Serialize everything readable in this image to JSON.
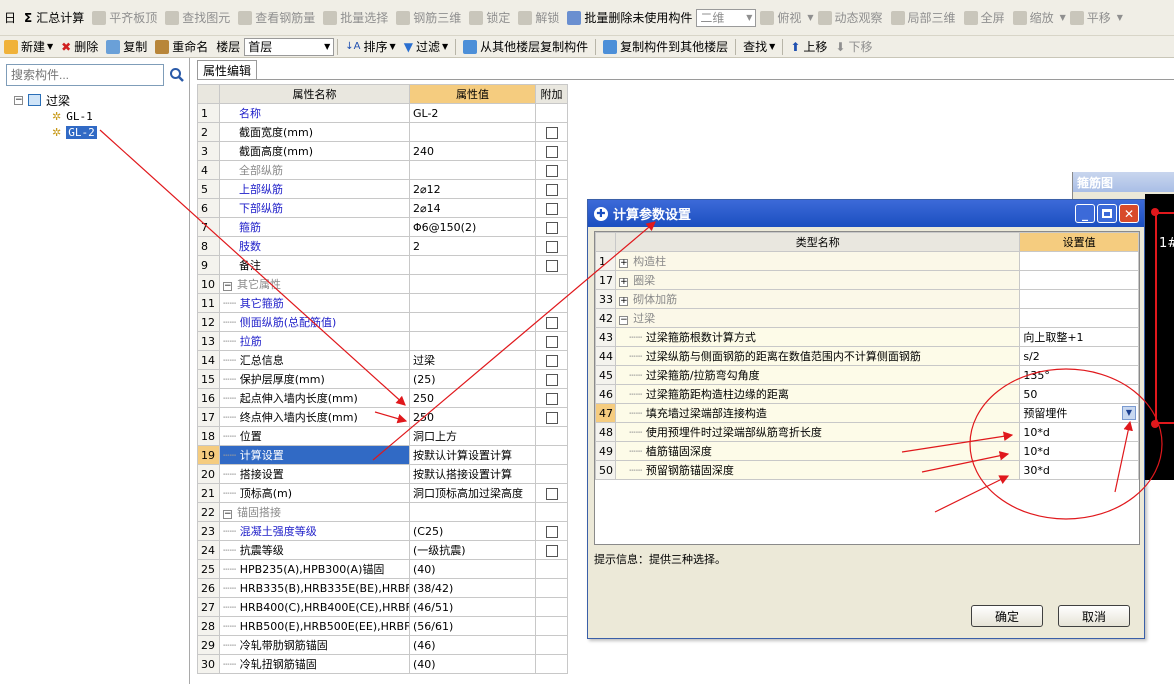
{
  "toolbar1": {
    "items": [
      {
        "label": "汇总计算",
        "enabled": true,
        "prefix": "Σ"
      },
      {
        "label": "平齐板顶",
        "enabled": false
      },
      {
        "label": "查找图元",
        "enabled": false
      },
      {
        "label": "查看钢筋量",
        "enabled": false
      },
      {
        "label": "批量选择",
        "enabled": false
      },
      {
        "label": "钢筋三维",
        "enabled": false
      },
      {
        "label": "锁定",
        "enabled": false
      },
      {
        "label": "解锁",
        "enabled": false
      },
      {
        "label": "批量删除未使用构件",
        "enabled": true
      },
      {
        "label": "二维",
        "enabled": false
      },
      {
        "label": "俯视",
        "enabled": false
      },
      {
        "label": "动态观察",
        "enabled": false
      },
      {
        "label": "局部三维",
        "enabled": false
      },
      {
        "label": "全屏",
        "enabled": false
      },
      {
        "label": "缩放",
        "enabled": false
      },
      {
        "label": "平移",
        "enabled": false
      }
    ]
  },
  "toolbar2": {
    "new_label": "新建",
    "delete_label": "删除",
    "copy_label": "复制",
    "rename_label": "重命名",
    "floor_label": "楼层",
    "floor_value": "首层",
    "sort_label": "排序",
    "filter_label": "过滤",
    "copy_from_floor_label": "从其他楼层复制构件",
    "copy_to_floor_label": "复制构件到其他楼层",
    "find_label": "查找",
    "move_up_label": "上移",
    "move_down_label": "下移"
  },
  "left_panel": {
    "search_placeholder": "搜索构件...",
    "tree_root": "过梁",
    "tree_children": [
      "GL-1",
      "GL-2"
    ],
    "selected": "GL-2"
  },
  "editor": {
    "tab_label": "属性编辑",
    "col_name": "属性名称",
    "col_value": "属性值",
    "col_extra": "附加",
    "rows": [
      {
        "n": "1",
        "name": "名称",
        "value": "GL-2",
        "style": "blue",
        "indent": 0,
        "cb": false
      },
      {
        "n": "2",
        "name": "截面宽度(mm)",
        "value": "",
        "style": "black",
        "indent": 0,
        "cb": true
      },
      {
        "n": "3",
        "name": "截面高度(mm)",
        "value": "240",
        "style": "black",
        "indent": 0,
        "cb": true
      },
      {
        "n": "4",
        "name": "全部纵筋",
        "value": "",
        "style": "gray",
        "indent": 0,
        "cb": true
      },
      {
        "n": "5",
        "name": "上部纵筋",
        "value": "2⌀12",
        "style": "blue",
        "indent": 0,
        "cb": true
      },
      {
        "n": "6",
        "name": "下部纵筋",
        "value": "2⌀14",
        "style": "blue",
        "indent": 0,
        "cb": true
      },
      {
        "n": "7",
        "name": "箍筋",
        "value": "Φ6@150(2)",
        "style": "blue",
        "indent": 0,
        "cb": true
      },
      {
        "n": "8",
        "name": "肢数",
        "value": "2",
        "style": "blue",
        "indent": 0,
        "cb": true
      },
      {
        "n": "9",
        "name": "备注",
        "value": "",
        "style": "black",
        "indent": 0,
        "cb": true
      },
      {
        "n": "10",
        "name": "其它属性",
        "value": "",
        "style": "gray",
        "indent": 0,
        "cb": false,
        "group": true
      },
      {
        "n": "11",
        "name": "其它箍筋",
        "value": "",
        "style": "blue",
        "indent": 1,
        "cb": false
      },
      {
        "n": "12",
        "name": "侧面纵筋(总配筋值)",
        "value": "",
        "style": "blue",
        "indent": 1,
        "cb": true
      },
      {
        "n": "13",
        "name": "拉筋",
        "value": "",
        "style": "blue",
        "indent": 1,
        "cb": true
      },
      {
        "n": "14",
        "name": "汇总信息",
        "value": "过梁",
        "style": "black",
        "indent": 1,
        "cb": true
      },
      {
        "n": "15",
        "name": "保护层厚度(mm)",
        "value": "(25)",
        "style": "black",
        "indent": 1,
        "cb": true
      },
      {
        "n": "16",
        "name": "起点伸入墙内长度(mm)",
        "value": "250",
        "style": "black",
        "indent": 1,
        "cb": true
      },
      {
        "n": "17",
        "name": "终点伸入墙内长度(mm)",
        "value": "250",
        "style": "black",
        "indent": 1,
        "cb": true
      },
      {
        "n": "18",
        "name": "位置",
        "value": "洞口上方",
        "style": "black",
        "indent": 1,
        "cb": false
      },
      {
        "n": "19",
        "name": "计算设置",
        "value": "按默认计算设置计算",
        "style": "black",
        "indent": 1,
        "cb": false,
        "selected": true
      },
      {
        "n": "20",
        "name": "搭接设置",
        "value": "按默认搭接设置计算",
        "style": "black",
        "indent": 1,
        "cb": false
      },
      {
        "n": "21",
        "name": "顶标高(m)",
        "value": "洞口顶标高加过梁高度",
        "style": "black",
        "indent": 1,
        "cb": true
      },
      {
        "n": "22",
        "name": "锚固搭接",
        "value": "",
        "style": "gray",
        "indent": 0,
        "cb": false,
        "group": true
      },
      {
        "n": "23",
        "name": "混凝土强度等级",
        "value": "(C25)",
        "style": "blue",
        "indent": 1,
        "cb": true
      },
      {
        "n": "24",
        "name": "抗震等级",
        "value": "(一级抗震)",
        "style": "black",
        "indent": 1,
        "cb": true
      },
      {
        "n": "25",
        "name": "HPB235(A),HPB300(A)锚固",
        "value": "(40)",
        "style": "black",
        "indent": 1,
        "cb": false
      },
      {
        "n": "26",
        "name": "HRB335(B),HRB335E(BE),HRBF",
        "value": "(38/42)",
        "style": "black",
        "indent": 1,
        "cb": false
      },
      {
        "n": "27",
        "name": "HRB400(C),HRB400E(CE),HRBF",
        "value": "(46/51)",
        "style": "black",
        "indent": 1,
        "cb": false
      },
      {
        "n": "28",
        "name": "HRB500(E),HRB500E(EE),HRBF",
        "value": "(56/61)",
        "style": "black",
        "indent": 1,
        "cb": false
      },
      {
        "n": "29",
        "name": "冷轧带肋钢筋锚固",
        "value": "(46)",
        "style": "black",
        "indent": 1,
        "cb": false
      },
      {
        "n": "30",
        "name": "冷轧扭钢筋锚固",
        "value": "(40)",
        "style": "black",
        "indent": 1,
        "cb": false
      }
    ]
  },
  "dialog": {
    "title": "计算参数设置",
    "col_type": "类型名称",
    "col_value": "设置值",
    "rows": [
      {
        "n": "1",
        "name": "构造柱",
        "value": "",
        "group": true,
        "collapsed": true,
        "gray": true
      },
      {
        "n": "17",
        "name": "圈梁",
        "value": "",
        "group": true,
        "collapsed": true,
        "gray": true
      },
      {
        "n": "33",
        "name": "砌体加筋",
        "value": "",
        "group": true,
        "collapsed": true,
        "gray": true
      },
      {
        "n": "42",
        "name": "过梁",
        "value": "",
        "group": true,
        "collapsed": false,
        "gray": true
      },
      {
        "n": "43",
        "name": "过梁箍筋根数计算方式",
        "value": "向上取整+1"
      },
      {
        "n": "44",
        "name": "过梁纵筋与侧面钢筋的距离在数值范围内不计算侧面钢筋",
        "value": "s/2"
      },
      {
        "n": "45",
        "name": "过梁箍筋/拉筋弯勾角度",
        "value": "135°"
      },
      {
        "n": "46",
        "name": "过梁箍筋距构造柱边缘的距离",
        "value": "50"
      },
      {
        "n": "47",
        "name": "填充墙过梁端部连接构造",
        "value": "预留埋件",
        "selected": true,
        "dropdown": true
      },
      {
        "n": "48",
        "name": "使用预埋件时过梁端部纵筋弯折长度",
        "value": "10*d"
      },
      {
        "n": "49",
        "name": "植筋锚固深度",
        "value": "10*d"
      },
      {
        "n": "50",
        "name": "预留钢筋锚固深度",
        "value": "30*d"
      }
    ],
    "hint": "提示信息：提供三种选择。",
    "ok_label": "确定",
    "cancel_label": "取消"
  },
  "right_panel": {
    "title": "箍筋图"
  },
  "colors": {
    "annotation_red": "#e0181c",
    "header_orange": "#f5cc7f",
    "selection_blue": "#316ac5",
    "dialog_title_blue": "#245edb"
  }
}
